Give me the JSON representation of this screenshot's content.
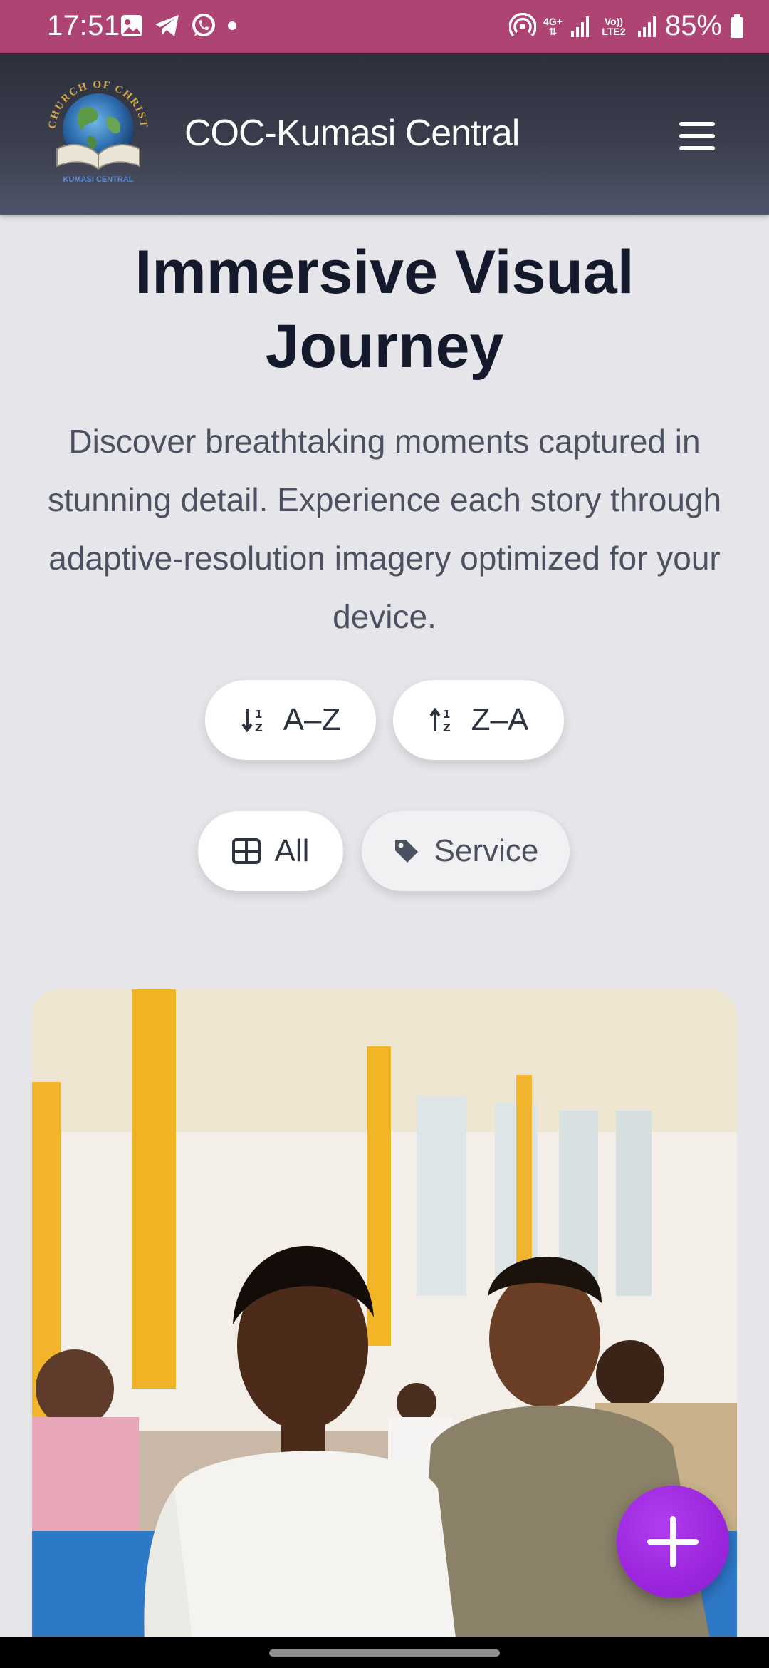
{
  "status_bar": {
    "time": "17:51",
    "battery": "85%",
    "network_label": "4G+",
    "volte_label": "Vo)) LTE2"
  },
  "header": {
    "title": "COC-Kumasi Central",
    "logo_top_text": "CHURCH OF CHRIST",
    "logo_bottom_text": "KUMASI CENTRAL"
  },
  "hero": {
    "title": "Immersive Visual Journey",
    "description": "Discover breathtaking moments captured in stunning detail. Experience each story through adaptive-resolution imagery optimized for your device."
  },
  "sort": {
    "asc_label": "A–Z",
    "desc_label": "Z–A"
  },
  "filters": {
    "all_label": "All",
    "service_label": "Service",
    "active": "All"
  },
  "gallery": {
    "first_image_icon": "photo-congregation"
  },
  "fab": {
    "icon": "plus-icon"
  },
  "colors": {
    "status_bar": "#ae4473",
    "nav_dark": "#2c303c",
    "page_bg": "#e5e5ea",
    "title": "#141a2b",
    "fab": "#9b26dd"
  }
}
